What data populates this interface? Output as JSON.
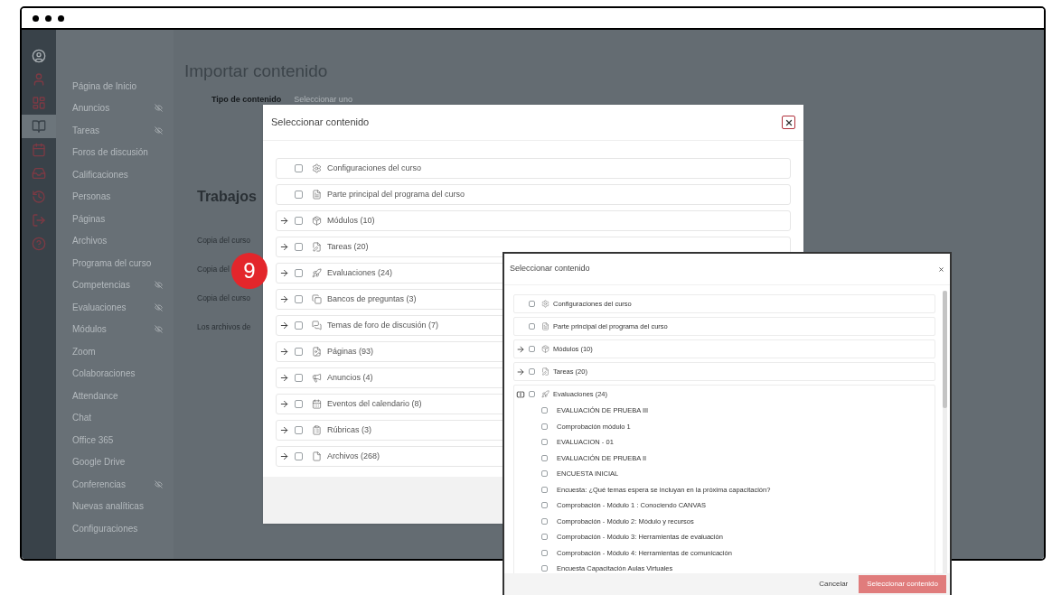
{
  "rail": [
    {
      "kind": "avatar",
      "selected": false
    },
    {
      "kind": "account",
      "selected": false
    },
    {
      "kind": "dashboard",
      "selected": false
    },
    {
      "kind": "courses",
      "selected": true
    },
    {
      "kind": "calendar",
      "selected": false
    },
    {
      "kind": "inbox",
      "selected": false
    },
    {
      "kind": "history",
      "selected": false
    },
    {
      "kind": "logout",
      "selected": false
    },
    {
      "kind": "help",
      "selected": false
    }
  ],
  "course_nav": [
    {
      "label": "Página de Inicio",
      "hidden": false
    },
    {
      "label": "Anuncios",
      "hidden": true
    },
    {
      "label": "Tareas",
      "hidden": true
    },
    {
      "label": "Foros de discusión",
      "hidden": false
    },
    {
      "label": "Calificaciones",
      "hidden": false
    },
    {
      "label": "Personas",
      "hidden": false
    },
    {
      "label": "Páginas",
      "hidden": false
    },
    {
      "label": "Archivos",
      "hidden": false
    },
    {
      "label": "Programa del curso",
      "hidden": false
    },
    {
      "label": "Competencias",
      "hidden": true
    },
    {
      "label": "Evaluaciones",
      "hidden": true
    },
    {
      "label": "Módulos",
      "hidden": true
    },
    {
      "label": "Zoom",
      "hidden": false
    },
    {
      "label": "Colaboraciones",
      "hidden": false
    },
    {
      "label": "Attendance",
      "hidden": false
    },
    {
      "label": "Chat",
      "hidden": false
    },
    {
      "label": "Office 365",
      "hidden": false
    },
    {
      "label": "Google Drive",
      "hidden": false
    },
    {
      "label": "Conferencias",
      "hidden": true
    },
    {
      "label": "Nuevas analíticas",
      "hidden": false
    },
    {
      "label": "Configuraciones",
      "hidden": false
    }
  ],
  "page": {
    "title": "Importar contenido",
    "content_type": {
      "label": "Tipo de contenido",
      "value": "Seleccionar uno"
    },
    "section_title": "Trabajos",
    "jobs": [
      "Copia del curso",
      "Copia del",
      "Copia del curso",
      "Los archivos de"
    ]
  },
  "step_badge": "9",
  "modal": {
    "title": "Seleccionar contenido",
    "items": [
      {
        "kind": "settings",
        "label": "Configuraciones del curso",
        "expandable": false,
        "checked": false
      },
      {
        "kind": "syllabus",
        "label": "Parte principal del programa del curso",
        "expandable": false,
        "checked": false
      },
      {
        "kind": "modules",
        "label": "Módulos (10)",
        "expandable": true,
        "checked": false
      },
      {
        "kind": "assignments",
        "label": "Tareas (20)",
        "expandable": true,
        "checked": false
      },
      {
        "kind": "quizzes",
        "label": "Evaluaciones (24)",
        "expandable": true,
        "checked": false
      },
      {
        "kind": "banks",
        "label": "Bancos de preguntas (3)",
        "expandable": true,
        "checked": false
      },
      {
        "kind": "discussions",
        "label": "Temas de foro de discusión (7)",
        "expandable": true,
        "checked": false
      },
      {
        "kind": "pages",
        "label": "Páginas (93)",
        "expandable": true,
        "checked": false
      },
      {
        "kind": "announcements",
        "label": "Anuncios (4)",
        "expandable": true,
        "checked": false
      },
      {
        "kind": "calendar",
        "label": "Eventos del calendario (8)",
        "expandable": true,
        "checked": false
      },
      {
        "kind": "rubrics",
        "label": "Rúbricas (3)",
        "expandable": true,
        "checked": false
      },
      {
        "kind": "files",
        "label": "Archivos (268)",
        "expandable": true,
        "checked": false
      }
    ]
  },
  "zoom_modal": {
    "title": "Seleccionar contenido",
    "items": [
      {
        "kind": "settings",
        "label": "Configuraciones del curso",
        "expandable": false,
        "checked": false
      },
      {
        "kind": "syllabus",
        "label": "Parte principal del programa del curso",
        "expandable": false,
        "checked": false
      },
      {
        "kind": "modules",
        "label": "Módulos (10)",
        "expandable": true,
        "expanded": false,
        "checked": false
      },
      {
        "kind": "assignments",
        "label": "Tareas (20)",
        "expandable": true,
        "expanded": false,
        "checked": false
      },
      {
        "kind": "quizzes",
        "label": "Evaluaciones (24)",
        "expandable": true,
        "expanded": true,
        "checked": false,
        "children": [
          {
            "label": "EVALUACIÓN DE PRUEBA III",
            "checked": false
          },
          {
            "label": "Comprobación módulo 1",
            "checked": false
          },
          {
            "label": "EVALUACION - 01",
            "checked": false
          },
          {
            "label": "EVALUACIÓN DE PRUEBA II",
            "checked": false
          },
          {
            "label": "ENCUESTA INICIAL",
            "checked": false
          },
          {
            "label": "Encuesta: ¿Qué temas espera se incluyan en la próxima capacitación?",
            "checked": false
          },
          {
            "label": "Comprobación - Módulo 1 : Conociendo CANVAS",
            "checked": false
          },
          {
            "label": "Comprobación - Módulo 2: Módulo y recursos",
            "checked": false
          },
          {
            "label": "Comprobación - Módulo 3: Herramientas de evaluación",
            "checked": false
          },
          {
            "label": "Comprobación - Módulo 4: Herramientas de comunicación",
            "checked": false
          },
          {
            "label": "Encuesta Capacitación Aulas Virtuales",
            "checked": false
          }
        ]
      }
    ],
    "buttons": {
      "cancel": "Cancelar",
      "submit": "Seleccionar contenido"
    }
  }
}
